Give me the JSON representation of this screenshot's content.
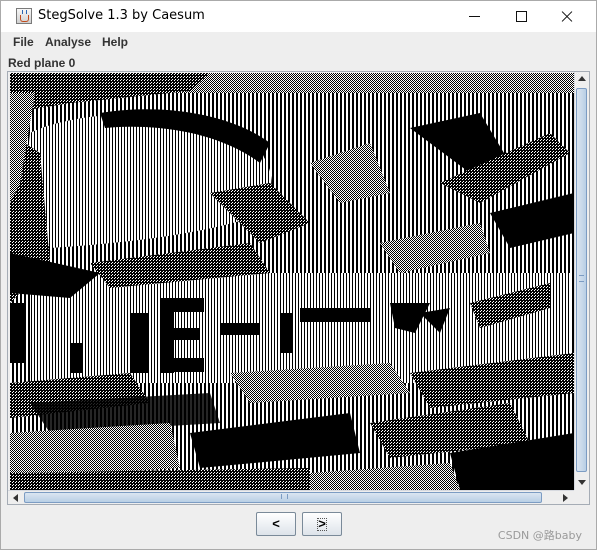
{
  "window": {
    "title": "StegSolve 1.3 by Caesum"
  },
  "menu": {
    "items": [
      {
        "label": "File"
      },
      {
        "label": "Analyse"
      },
      {
        "label": "Help"
      }
    ]
  },
  "plane_label": "Red plane 0",
  "image": {
    "description_icon": "bitplane-image",
    "colors": {
      "ink": "#000000",
      "paper": "#ffffff"
    }
  },
  "navigation": {
    "prev_label": "<",
    "next_label": ">"
  },
  "watermark": "CSDN @路baby"
}
